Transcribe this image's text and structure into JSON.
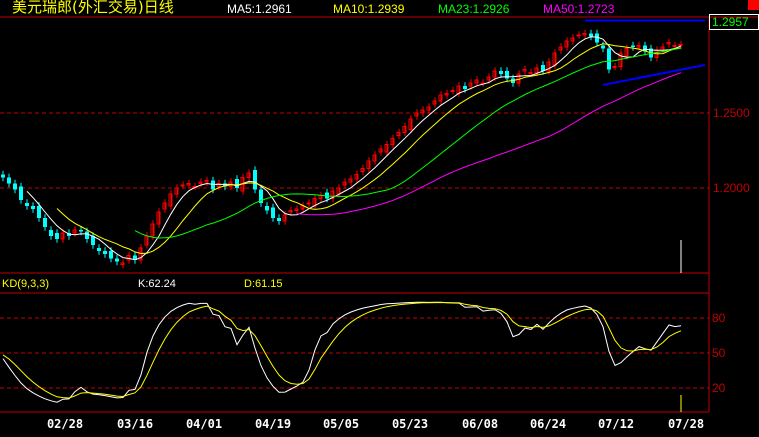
{
  "header": {
    "title": "美元瑞郎(外汇交易)日线",
    "ma5": "MA5:1.2961",
    "ma10": "MA10:1.2939",
    "ma23": "MA23:1.2926",
    "ma50": "MA50:1.2723"
  },
  "kd_panel": {
    "title": "KD(9,3,3)",
    "k": "K:62.24",
    "d": "D:61.15"
  },
  "colors": {
    "up": "#ff0000",
    "down": "#00ffff",
    "ma5": "#ffffff",
    "ma10": "#ffff00",
    "ma23": "#00ff00",
    "ma50": "#ff00ff",
    "grid": "#c00000",
    "trendline": "#0000ff"
  },
  "chart_data": [
    {
      "type": "candlestick",
      "title": "美元瑞郎(外汇交易)日线",
      "last_price": "1.2957",
      "y_ticks": [
        "1.2500",
        "1.2000"
      ],
      "ylim": [
        1.143,
        1.312
      ],
      "x_ticks": [
        "02/28",
        "03/16",
        "04/01",
        "04/19",
        "05/05",
        "05/23",
        "06/08",
        "06/24",
        "07/12",
        "07/28"
      ],
      "close": [
        1.207,
        1.203,
        1.199,
        1.192,
        1.188,
        1.186,
        1.18,
        1.174,
        1.168,
        1.166,
        1.17,
        1.168,
        1.172,
        1.171,
        1.166,
        1.162,
        1.158,
        1.156,
        1.153,
        1.151,
        1.15,
        1.155,
        1.152,
        1.16,
        1.168,
        1.176,
        1.184,
        1.19,
        1.196,
        1.2,
        1.202,
        1.203,
        1.201,
        1.204,
        1.205,
        1.199,
        1.203,
        1.201,
        1.204,
        1.2,
        1.207,
        1.21,
        1.199,
        1.19,
        1.185,
        1.18,
        1.178,
        1.182,
        1.185,
        1.186,
        1.188,
        1.19,
        1.193,
        1.195,
        1.193,
        1.198,
        1.2,
        1.204,
        1.206,
        1.209,
        1.213,
        1.218,
        1.222,
        1.226,
        1.229,
        1.233,
        1.237,
        1.241,
        1.246,
        1.25,
        1.252,
        1.254,
        1.258,
        1.262,
        1.263,
        1.265,
        1.268,
        1.266,
        1.27,
        1.272,
        1.27,
        1.274,
        1.278,
        1.276,
        1.273,
        1.27,
        1.276,
        1.279,
        1.277,
        1.28,
        1.278,
        1.284,
        1.29,
        1.294,
        1.298,
        1.3,
        1.302,
        1.303,
        1.301,
        1.297,
        1.293,
        1.279,
        1.281,
        1.29,
        1.293,
        1.294,
        1.295,
        1.291,
        1.287,
        1.292,
        1.294,
        1.297,
        1.295,
        1.2957
      ],
      "moving_averages": [
        5,
        10,
        23,
        50
      ],
      "trendlines": [
        {
          "from_index": 97,
          "to_index": 117,
          "from_price": 1.3117,
          "to_price": 1.3117
        },
        {
          "from_index": 100,
          "to_index": 117,
          "from_price": 1.2687,
          "to_price": 1.282
        }
      ]
    },
    {
      "type": "line",
      "title": "KD(9,3,3)",
      "series": [
        "K",
        "D"
      ],
      "y_ticks": [
        "80",
        "50",
        "20"
      ],
      "ylim": [
        0,
        100
      ]
    }
  ]
}
